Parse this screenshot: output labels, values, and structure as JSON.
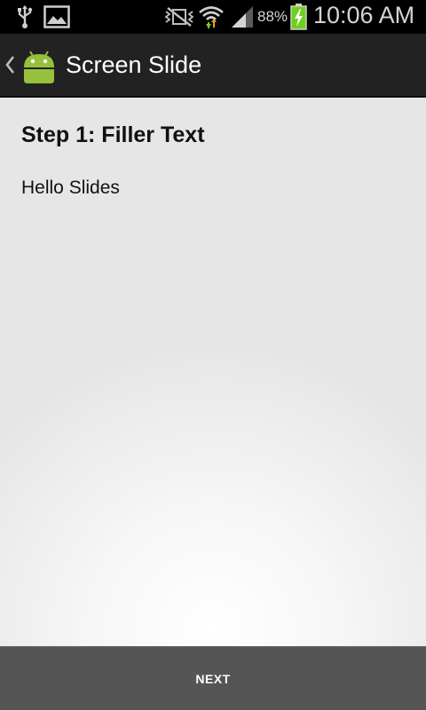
{
  "status_bar": {
    "battery_percent": "88%",
    "time": "10:06 AM",
    "icons": [
      "usb-icon",
      "image-notification-icon",
      "vibrate-mute-icon",
      "wifi-icon",
      "cell-signal-icon",
      "battery-charging-icon"
    ],
    "battery_color": "#6fcf1f",
    "wifi_arrow_up_color": "#f0a020",
    "wifi_arrow_down_color": "#6fcf1f"
  },
  "action_bar": {
    "title": "Screen Slide",
    "up_icon": "chevron-left-icon",
    "app_icon": "android-icon",
    "app_icon_color": "#97c03d"
  },
  "content": {
    "step_title": "Step 1: Filler Text",
    "body": "Hello Slides"
  },
  "footer": {
    "next_label": "NEXT"
  }
}
